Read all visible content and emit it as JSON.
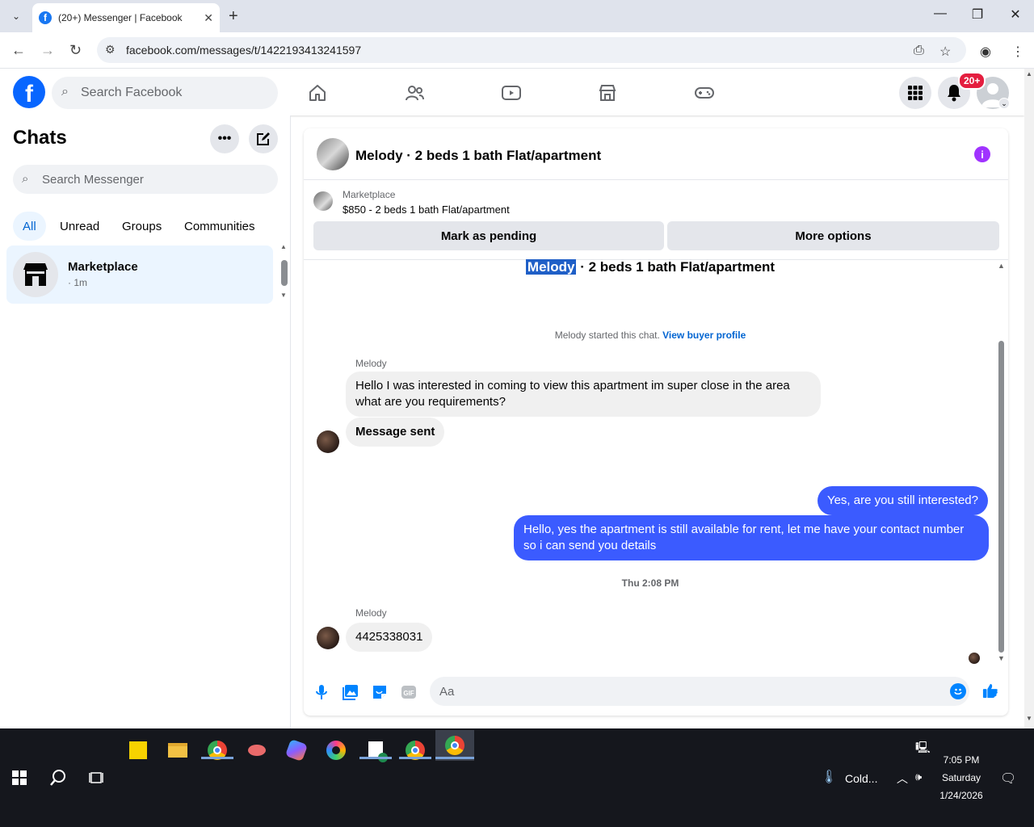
{
  "browser": {
    "tab_title": "(20+) Messenger | Facebook",
    "tab_favicon": "f",
    "url": "facebook.com/messages/t/1422193413241597"
  },
  "header": {
    "search_placeholder": "Search Facebook",
    "notification_badge": "20+"
  },
  "sidebar": {
    "title": "Chats",
    "search_placeholder": "Search Messenger",
    "filters": [
      "All",
      "Unread",
      "Groups",
      "Communities"
    ],
    "active_filter": "All",
    "chats": [
      {
        "name": "Marketplace",
        "time": "· 1m"
      }
    ]
  },
  "chat": {
    "title": "Melody · 2 beds 1 bath Flat/apartment",
    "marketplace_label": "Marketplace",
    "listing": "$850 - 2 beds 1 bath Flat/apartment",
    "buttons": {
      "pending": "Mark as pending",
      "more": "More options"
    },
    "listing_header_name": "Melody",
    "listing_header_rest": " · 2 beds 1 bath Flat/apartment",
    "system_text": "Melody started this chat.",
    "system_link": "View buyer profile",
    "messages": [
      {
        "sender": "Melody",
        "text": "Hello I was interested in coming to view this apartment im super close in the area what are you requirements?"
      },
      {
        "text": "Message sent"
      },
      {
        "text": "Yes, are you still interested?"
      },
      {
        "text": "Hello, yes the apartment is still available for rent, let me have your contact number so i can send you details"
      },
      {
        "sender": "Melody",
        "text": "4425338031"
      }
    ],
    "timestamp": "Thu 2:08 PM",
    "composer_placeholder": "Aa"
  },
  "taskbar": {
    "weather": "Cold...",
    "time": "7:05 PM",
    "day": "Saturday",
    "date": "1/24/2026"
  },
  "colors": {
    "brand": "#0866ff",
    "outgoing_bubble": "#3b5bff",
    "active_chat_bg": "#ebf5ff",
    "info_icon": "#a033ff",
    "badge": "#e41e3f"
  }
}
